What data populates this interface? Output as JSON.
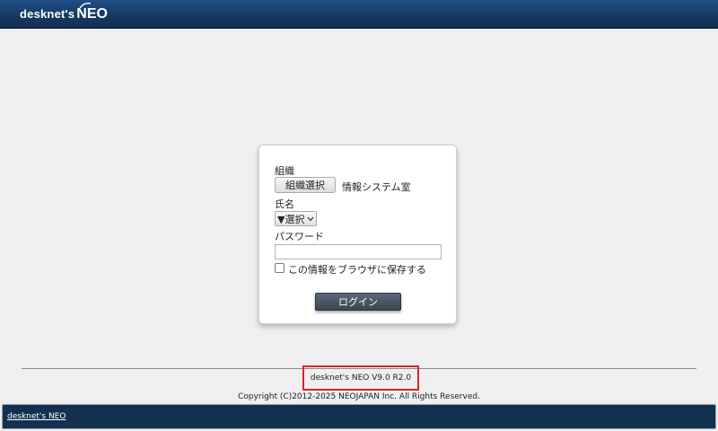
{
  "header": {
    "logo_text": "desknet's",
    "logo_brand": "NEO"
  },
  "login": {
    "org_label": "組織",
    "org_button": "組織選択",
    "org_value": "情報システム室",
    "name_label": "氏名",
    "name_select": "▼選択",
    "password_label": "パスワード",
    "password_value": "",
    "remember_label": "この情報をブラウザに保存する",
    "login_button": "ログイン"
  },
  "footer": {
    "version": "desknet's NEO V9.0 R2.0",
    "copyright": "Copyright (C)2012-2025 NEOJAPAN Inc. All Rights Reserved.",
    "taskbar_link": "desknet's NEO"
  },
  "colors": {
    "header": "#16385f",
    "login_button": "#3a4554",
    "highlight": "#e0202a",
    "taskbar": "#14304f"
  }
}
